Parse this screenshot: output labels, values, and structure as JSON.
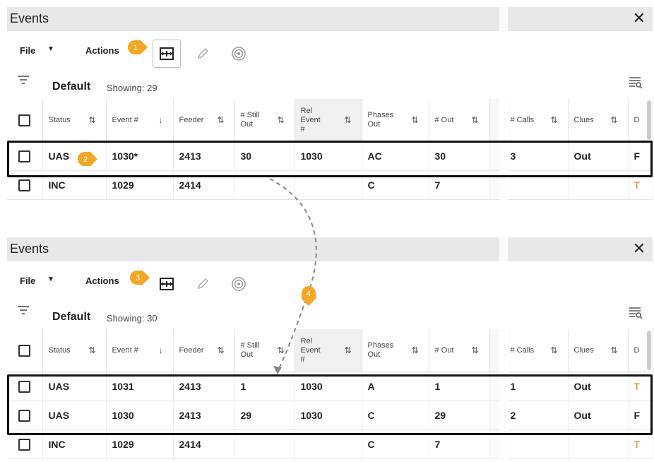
{
  "window": {
    "title": "Events",
    "close_glyph": "✕"
  },
  "toolbar": {
    "file_label": "File",
    "actions_label": "Actions"
  },
  "filterbar": {
    "view_name": "Default"
  },
  "columns": [
    {
      "key": "status",
      "label": "Status",
      "sort": "⇅"
    },
    {
      "key": "event",
      "label": "Event #",
      "sort": "↓"
    },
    {
      "key": "feeder",
      "label": "Feeder",
      "sort": "⇅"
    },
    {
      "key": "still_out",
      "label": "# Still Out",
      "sort": "⇅"
    },
    {
      "key": "rel_event",
      "label": "Rel Event #",
      "sort": "⇅"
    },
    {
      "key": "phases_out",
      "label": "Phases Out",
      "sort": "⇅"
    },
    {
      "key": "out",
      "label": "# Out",
      "sort": "⇅"
    },
    {
      "key": "hidden",
      "label": "",
      "sort": ""
    },
    {
      "key": "calls",
      "label": "# Calls",
      "sort": "⇅"
    },
    {
      "key": "clues",
      "label": "Clues",
      "sort": "⇅"
    },
    {
      "key": "extra",
      "label": "D",
      "sort": ""
    }
  ],
  "before": {
    "showing": "Showing: 29",
    "rows": [
      {
        "status": "UAS",
        "event": "1030*",
        "feeder": "2413",
        "still_out": "30",
        "rel_event": "1030",
        "phases_out": "AC",
        "out": "30",
        "calls": "3",
        "clues": "Out",
        "extra": "F"
      },
      {
        "status": "INC",
        "event": "1029",
        "feeder": "2414",
        "still_out": "",
        "rel_event": "",
        "phases_out": "C",
        "out": "7",
        "calls": "",
        "clues": "",
        "extra": "T"
      }
    ]
  },
  "after": {
    "showing": "Showing: 30",
    "rows": [
      {
        "status": "UAS",
        "event": "1031",
        "feeder": "2413",
        "still_out": "1",
        "rel_event": "1030",
        "phases_out": "A",
        "out": "1",
        "calls": "1",
        "clues": "Out",
        "extra": "T"
      },
      {
        "status": "UAS",
        "event": "1030",
        "feeder": "2413",
        "still_out": "29",
        "rel_event": "1030",
        "phases_out": "C",
        "out": "29",
        "calls": "2",
        "clues": "Out",
        "extra": "F"
      },
      {
        "status": "INC",
        "event": "1029",
        "feeder": "2414",
        "still_out": "",
        "rel_event": "",
        "phases_out": "C",
        "out": "7",
        "calls": "",
        "clues": "",
        "extra": "T"
      }
    ]
  },
  "callouts": [
    "1",
    "2",
    "3",
    "4"
  ],
  "colors": {
    "callout": "#f5a623",
    "titlebar": "#e8e8e8",
    "highlight": "#111111"
  },
  "icons": [
    "split-event-icon",
    "edit-pencil-icon",
    "target-icon",
    "filter-icon",
    "search-list-icon"
  ]
}
